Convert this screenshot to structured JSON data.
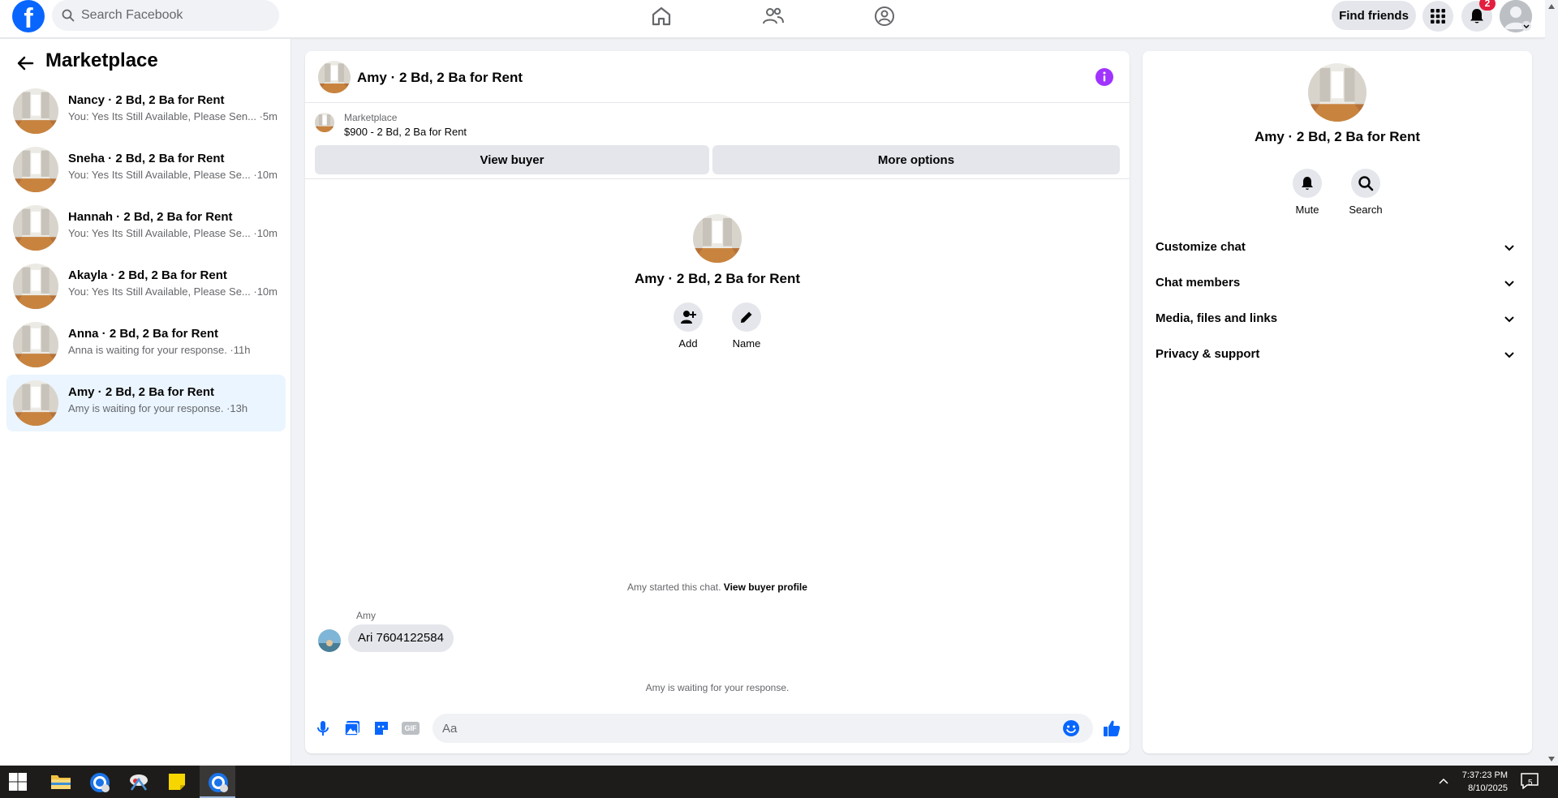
{
  "topbar": {
    "logo_letter": "f",
    "search_placeholder": "Search Facebook",
    "find_friends_label": "Find friends",
    "notification_count": "2"
  },
  "sidebar": {
    "title": "Marketplace",
    "conversations": [
      {
        "name": "Nancy · 2 Bd, 2 Ba for Rent",
        "preview": "You: Yes Its Still Available, Please Sen... ·5m"
      },
      {
        "name": "Sneha · 2 Bd, 2 Ba for Rent",
        "preview": "You: Yes Its Still Available, Please Se... ·10m"
      },
      {
        "name": "Hannah · 2 Bd, 2 Ba for Rent",
        "preview": "You: Yes Its Still Available, Please Se... ·10m"
      },
      {
        "name": "Akayla · 2 Bd, 2 Ba for Rent",
        "preview": "You: Yes Its Still Available, Please Se... ·10m"
      },
      {
        "name": "Anna · 2 Bd, 2 Ba for Rent",
        "preview": "Anna is waiting for your response. ·11h"
      },
      {
        "name": "Amy · 2 Bd, 2 Ba for Rent",
        "preview": "Amy is waiting for your response. ·13h"
      }
    ]
  },
  "chat": {
    "title": "Amy · 2 Bd, 2 Ba for Rent",
    "listing_source": "Marketplace",
    "listing_title": "$900 - 2 Bd, 2 Ba for Rent",
    "view_buyer_label": "View buyer",
    "more_options_label": "More options",
    "hero_name": "Amy · 2 Bd, 2 Ba for Rent",
    "add_label": "Add",
    "name_label": "Name",
    "started_text": "Amy started this chat.",
    "view_buyer_profile_label": "View buyer profile",
    "message_sender": "Amy",
    "message_text": "Ari  7604122584",
    "waiting_text": "Amy is waiting for your response.",
    "composer_placeholder": "Aa",
    "gif_label": "GIF"
  },
  "right_panel": {
    "name": "Amy · 2 Bd, 2 Ba for Rent",
    "mute_label": "Mute",
    "search_label": "Search",
    "sections": [
      "Customize chat",
      "Chat members",
      "Media, files and links",
      "Privacy & support"
    ]
  },
  "taskbar": {
    "time": "7:37:23 PM",
    "date": "8/10/2025",
    "notification_count": "5"
  },
  "colors": {
    "brand_blue": "#0866ff",
    "accent_purple": "#a033ff",
    "active_conversation_bg": "#ebf5ff",
    "notification_red": "#e41e3f"
  }
}
